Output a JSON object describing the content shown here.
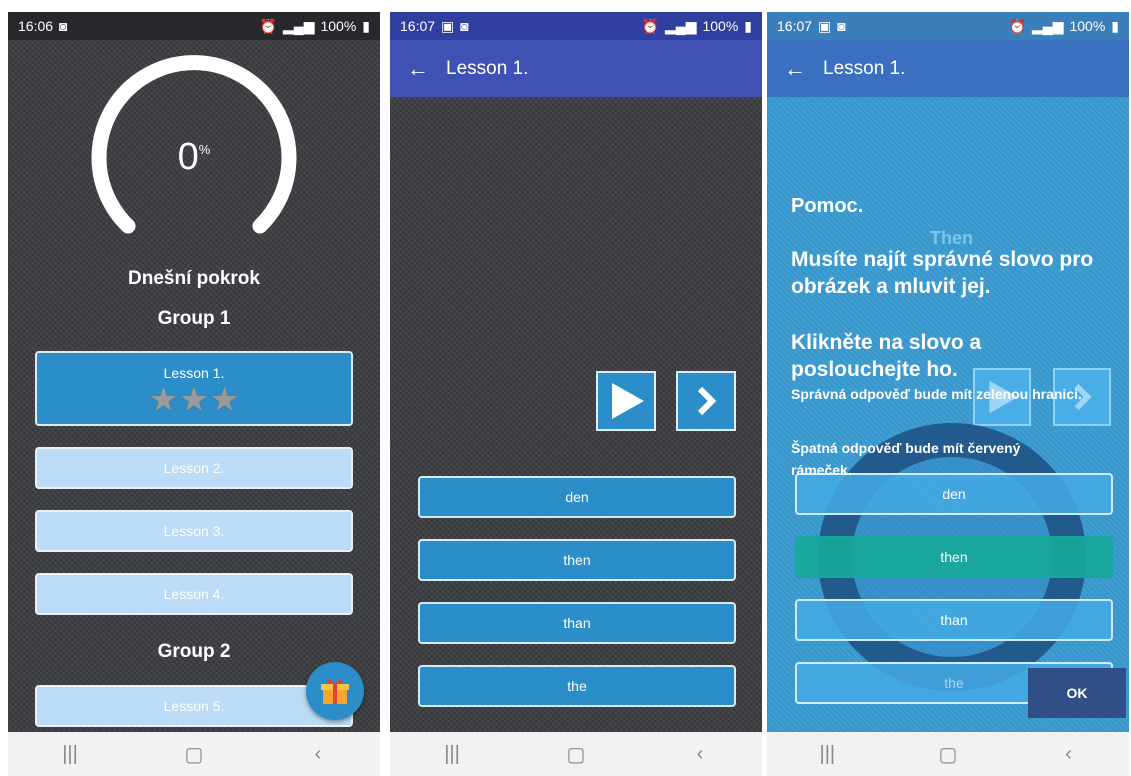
{
  "panel1": {
    "status": {
      "time": "16:06",
      "battery": "100%"
    },
    "progress": {
      "value": "0",
      "unit": "%",
      "fraction": 0
    },
    "today_label": "Dnešní pokrok",
    "group1": "Group 1",
    "group2": "Group 2",
    "lessons": [
      {
        "label": "Lesson 1.",
        "stars": 3,
        "state": "active"
      },
      {
        "label": "Lesson 2.",
        "state": "locked"
      },
      {
        "label": "Lesson 3.",
        "state": "locked"
      },
      {
        "label": "Lesson 4.",
        "state": "locked"
      },
      {
        "label": "Lesson 5.",
        "state": "locked"
      }
    ],
    "fab_icon": "gift-icon"
  },
  "panel2": {
    "status": {
      "time": "16:07",
      "battery": "100%"
    },
    "title": "Lesson 1.",
    "answers": [
      "den",
      "then",
      "than",
      "the"
    ]
  },
  "panel3": {
    "status": {
      "time": "16:07",
      "battery": "100%"
    },
    "title": "Lesson 1.",
    "help": {
      "title": "Pomoc.",
      "line1": "Musíte najít správné slovo pro obrázek a mluvit jej.",
      "line2": "Klikněte na slovo a poslouchejte ho.",
      "line3": "Správná odpověď bude mít zelenou hranici.",
      "line4": "Špatná odpověď bude mít červený rámeček."
    },
    "ghost_word": "Then",
    "answers": [
      "den",
      "then",
      "than",
      "the"
    ],
    "ok_label": "OK"
  },
  "colors": {
    "appbar": "#3f51b5",
    "button": "#2b8ec9",
    "correct": "#16a89a",
    "ok": "#2f4f86"
  }
}
